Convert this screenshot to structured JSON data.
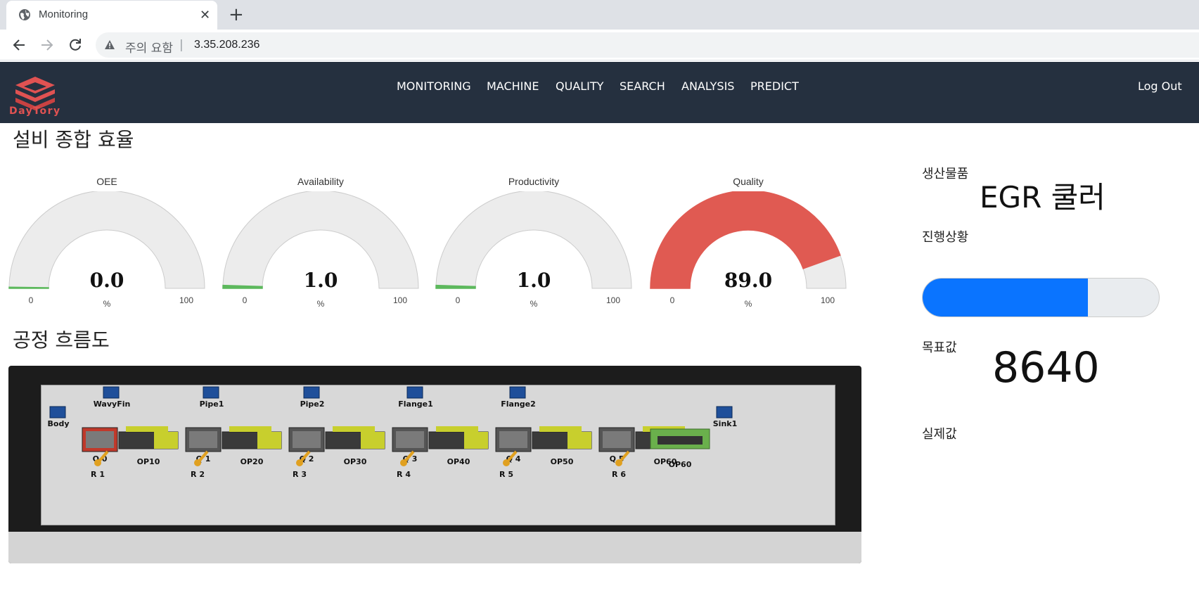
{
  "browser": {
    "tab_title": "Monitoring",
    "close_glyph": "✕",
    "new_tab_glyph": "+",
    "security_warning": "주의 요함",
    "separator": "|",
    "url": "3.35.208.236"
  },
  "app": {
    "logo_text": "DayTory",
    "nav": [
      {
        "label": "MONITORING"
      },
      {
        "label": "MACHINE"
      },
      {
        "label": "QUALITY"
      },
      {
        "label": "SEARCH"
      },
      {
        "label": "ANALYSIS"
      },
      {
        "label": "PREDICT"
      }
    ],
    "logout_label": "Log Out"
  },
  "oee_section": {
    "title": "설비 종합 효율",
    "gauges": [
      {
        "label": "OEE",
        "value": 0.0,
        "value_text": "0.0",
        "min": "0",
        "max": "100",
        "unit": "%",
        "color": "#5cb85c"
      },
      {
        "label": "Availability",
        "value": 1.0,
        "value_text": "1.0",
        "min": "0",
        "max": "100",
        "unit": "%",
        "color": "#5cb85c"
      },
      {
        "label": "Productivity",
        "value": 1.0,
        "value_text": "1.0",
        "min": "0",
        "max": "100",
        "unit": "%",
        "color": "#5cb85c"
      },
      {
        "label": "Quality",
        "value": 89.0,
        "value_text": "89.0",
        "min": "0",
        "max": "100",
        "unit": "%",
        "color": "#e05a52"
      }
    ]
  },
  "flow_section": {
    "title": "공정 흐름도",
    "labels": [
      "WavyFin",
      "Pipe1",
      "Pipe2",
      "Flange1",
      "Flange2",
      "Body",
      "Sink1",
      "Q 0",
      "OP10",
      "Q 1",
      "OP20",
      "Q 2",
      "OP30",
      "Q 3",
      "OP40",
      "Q 4",
      "OP50",
      "Q 5",
      "OP60",
      "R 1",
      "R 2",
      "R 3",
      "R 4",
      "R 5",
      "R 6"
    ]
  },
  "sidebar": {
    "product_label": "생산물품",
    "product_name": "EGR 쿨러",
    "progress_label": "진행상황",
    "progress_fraction": 0.7,
    "target_label": "목표값",
    "target_value": "8640",
    "actual_label": "실제값"
  },
  "colors": {
    "navbar_bg": "#25303f",
    "accent_red": "#e05252",
    "progress_blue": "#0a74ff",
    "gauge_bg": "#ececec"
  },
  "icons": [
    "globe-icon",
    "close-icon",
    "plus-icon",
    "back-arrow-icon",
    "forward-arrow-icon",
    "reload-icon",
    "warning-icon",
    "logo-icon"
  ]
}
